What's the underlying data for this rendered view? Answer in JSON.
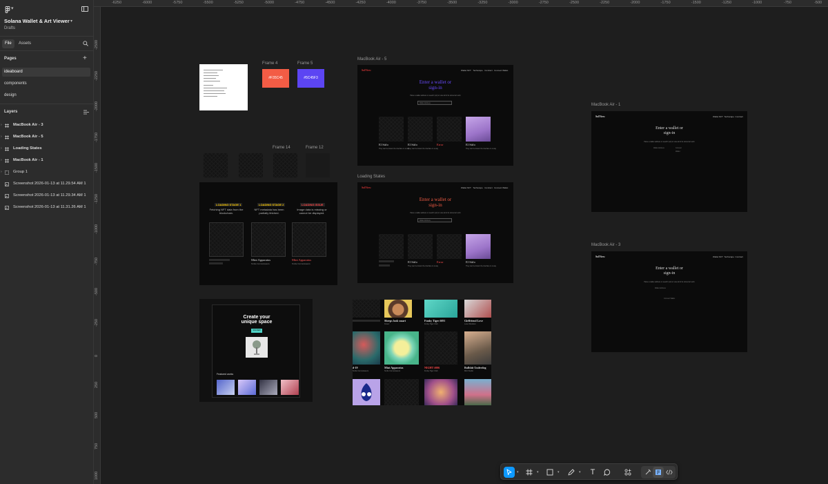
{
  "file": {
    "title": "Solana Wallet & Art Viewer",
    "subtitle": "Drafts",
    "tabs": [
      "File",
      "Assets"
    ]
  },
  "pages": {
    "title": "Pages",
    "items": [
      "ideaboard",
      "components",
      "design"
    ]
  },
  "layers": {
    "title": "Layers",
    "items": [
      {
        "name": "MacBook Air - 3",
        "kind": "frame"
      },
      {
        "name": "MacBook Air - 5",
        "kind": "frame"
      },
      {
        "name": "Loading States",
        "kind": "frame"
      },
      {
        "name": "MacBook Air - 1",
        "kind": "frame"
      },
      {
        "name": "Group 1",
        "kind": "group"
      },
      {
        "name": "Screenshot 2026-01-13 at 11.29.54 AM 1",
        "kind": "image"
      },
      {
        "name": "Screenshot 2026-01-13 at 11.29.34 AM 1",
        "kind": "image"
      },
      {
        "name": "Screenshot 2026-01-13 at 11.31.26 AM 1",
        "kind": "image"
      }
    ]
  },
  "ruler": {
    "top": [
      "-6250",
      "-6000",
      "-5750",
      "-5500",
      "-5250",
      "-5000",
      "-4750",
      "-4500",
      "-4250",
      "-4000",
      "-3750",
      "-3500",
      "-3250",
      "-3000",
      "-2750",
      "-2500",
      "-2250",
      "-2000",
      "-1750",
      "-1500",
      "-1250",
      "-1000",
      "-750",
      "-500"
    ],
    "left": [
      "-2500",
      "-2250",
      "-2000",
      "-1750",
      "-1500",
      "-1250",
      "-1000",
      "-750",
      "-500",
      "-250",
      "0",
      "250",
      "500",
      "750",
      "1000"
    ]
  },
  "canvas": {
    "labels": {
      "frame4": "Frame 4",
      "frame5": "Frame 5",
      "frame14": "Frame 14",
      "frame12": "Frame 12",
      "mba5": "MacBook Air - 5",
      "loading": "Loading States",
      "mba1": "MacBook Air - 1",
      "mba3": "MacBook Air - 3"
    },
    "swatches": [
      {
        "hex": "#F35C45",
        "color": "#f35c45"
      },
      {
        "hex": "#5C45F3",
        "color": "#5c45f3"
      }
    ],
    "app": {
      "brand": "SolView",
      "nav": [
        "Wallet NFT",
        "Techscape",
        "Contract",
        "Connect Wallet"
      ],
      "hero_line1": "Enter a wallet or",
      "hero_line2": "sign-in",
      "hero_sub": "Paste a wallet address or search (sol) to view all of its stored art work",
      "input_placeholder": "Wallet Address",
      "nft_name": "El Stifo",
      "nft_error": "Error",
      "nft_desc": "They can be known the interface in a way"
    },
    "loading": {
      "stages": [
        {
          "title": "LOADING STAGE 1",
          "desc": "Fetching NFT data from the blockchain."
        },
        {
          "title": "LOADING STAGE 2",
          "desc": "NFT metadata has been partially fetched."
        },
        {
          "title": "LOADING ISSUE",
          "desc": "Image data is missing or cannot be displayed."
        }
      ],
      "card_name": "Mint Apparatus",
      "card_sub": "Smile Connoisseurs"
    },
    "landing": {
      "title_line1": "Create your",
      "title_line2": "unique space",
      "cta": "SOLVIEW",
      "section": "Featured works"
    },
    "grid": {
      "cards": [
        {
          "name": "Sheeps look smart",
          "sub": "Kinecr"
        },
        {
          "name": "Funky Tiger #691",
          "sub": "Funky Tiger Club"
        },
        {
          "name": "Girlfriend Love",
          "sub": "Love Wonders"
        },
        {
          "name": "d-19",
          "sub": "Smile Connoisseurs"
        },
        {
          "name": "Mint Apparatus",
          "sub": "Smile Connoisseurs"
        },
        {
          "name": "NIGHT #006",
          "sub": "Funky Tiger Club"
        },
        {
          "name": "Bullshit Underdog",
          "sub": "Mint Studio"
        }
      ]
    }
  },
  "toolbar": {
    "tools": [
      "move-tool",
      "frame-tool",
      "shape-tool",
      "pen-tool",
      "text-tool",
      "comment-tool",
      "actions-tool"
    ],
    "accent": "#0d99ff"
  }
}
